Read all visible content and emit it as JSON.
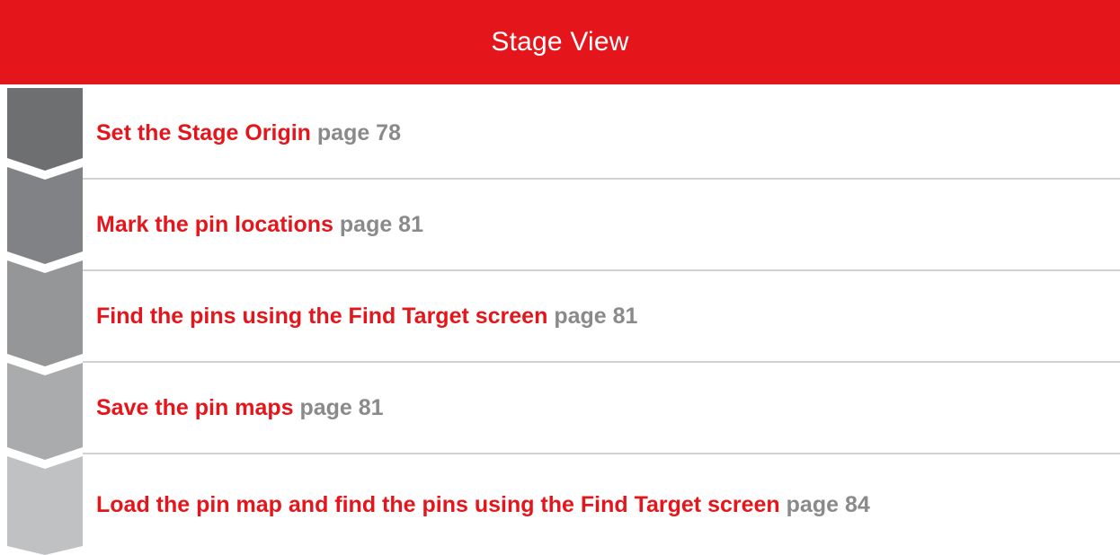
{
  "header": {
    "title": "Stage View"
  },
  "steps": [
    {
      "title": "Set the Stage Origin",
      "page": "page 78",
      "color": "#6e6f71"
    },
    {
      "title": "Mark the pin locations",
      "page": "page 81",
      "color": "#818285"
    },
    {
      "title": "Find the pins using the Find Target screen",
      "page": "page 81",
      "color": "#959698"
    },
    {
      "title": "Save the pin maps",
      "page": "page 81",
      "color": "#aaabad"
    },
    {
      "title": "Load the pin map and find the pins using the Find Target screen",
      "page": "page 84",
      "color": "#c0c1c3"
    }
  ],
  "colors": {
    "brand_red": "#e4161c",
    "page_ref_gray": "#8a8a8a",
    "divider": "#d2d2d2"
  }
}
